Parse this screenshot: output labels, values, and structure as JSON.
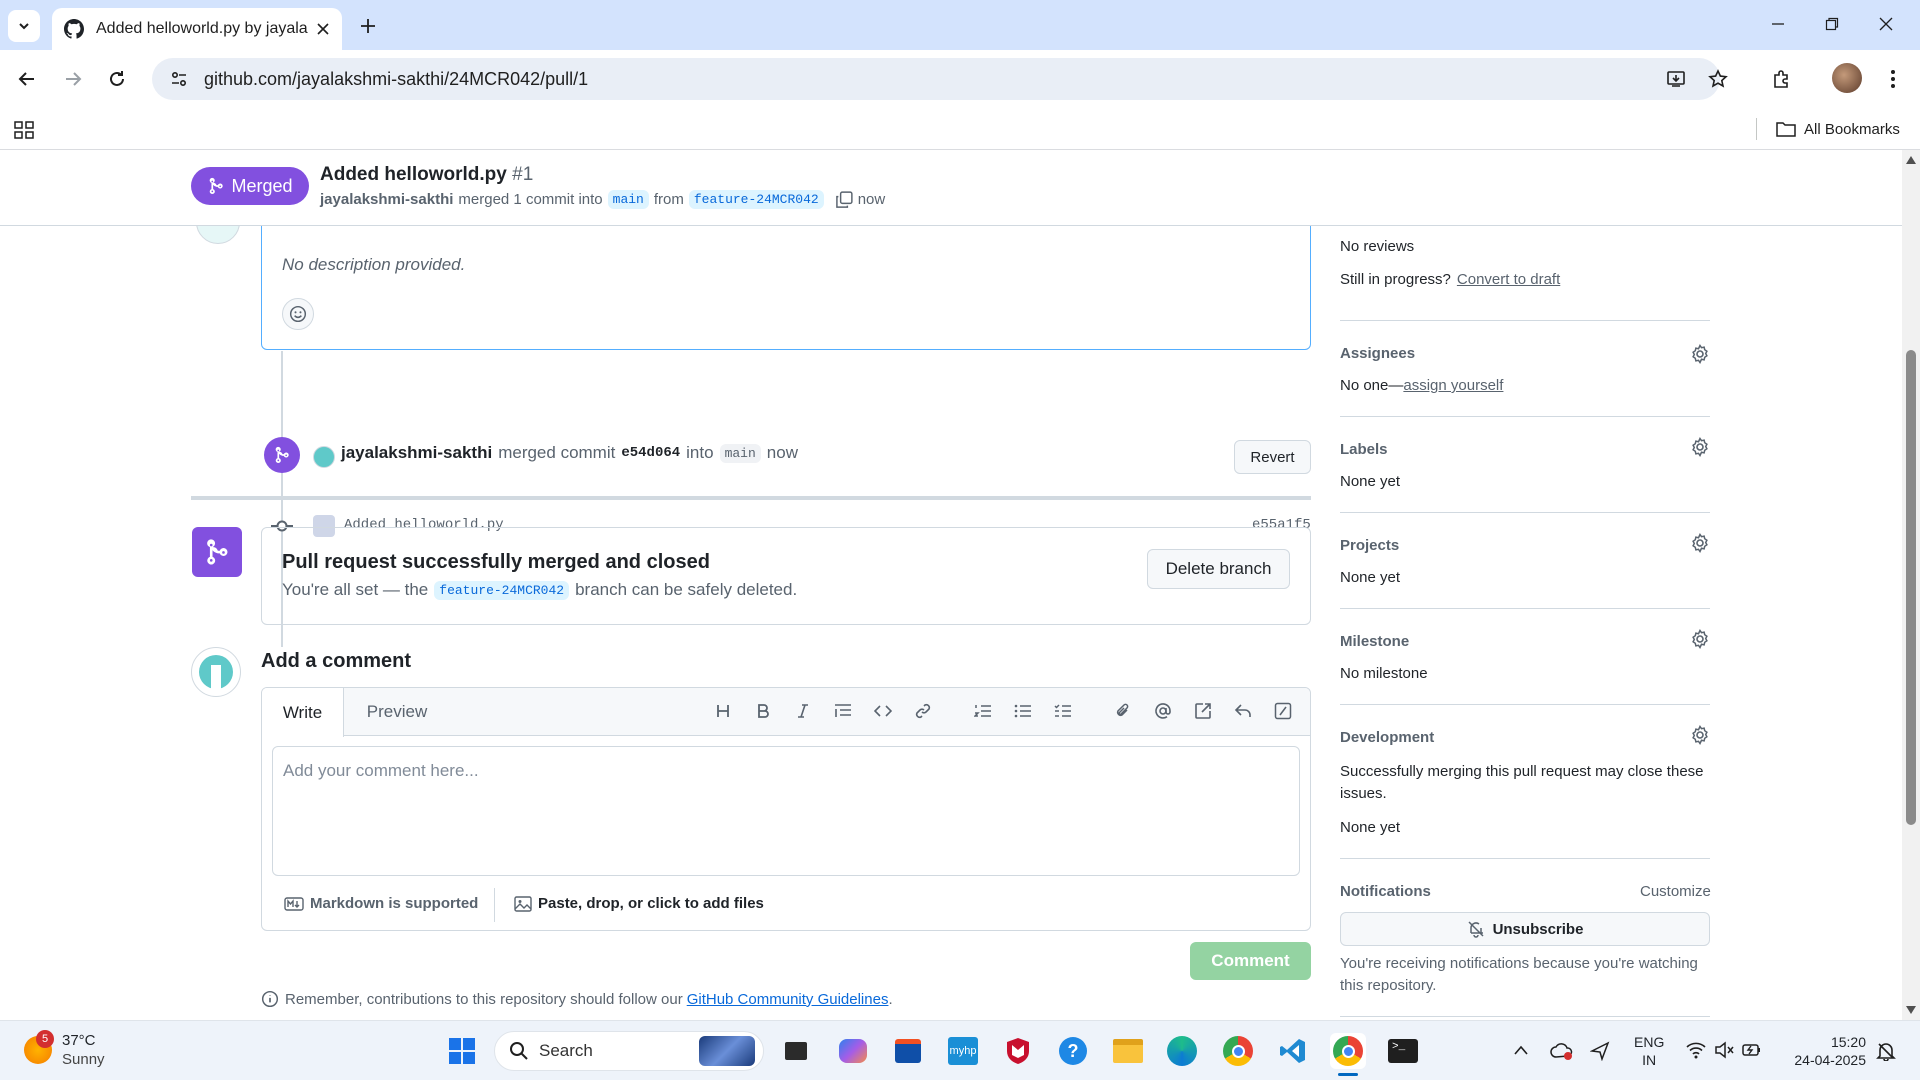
{
  "browser": {
    "tab_title": "Added helloworld.py by jayalakshmi-sakthi",
    "url": "github.com/jayalakshmi-sakthi/24MCR042/pull/1",
    "bookmarks_label": "All Bookmarks"
  },
  "pr": {
    "state_label": "Merged",
    "title": "Added helloworld.py",
    "number": "#1",
    "author": "jayalakshmi-sakthi",
    "merged_text": "merged 1 commit into",
    "base_branch": "main",
    "from_text": "from",
    "head_branch": "feature-24MCR042",
    "time": "now"
  },
  "timeline": {
    "description": "No description provided.",
    "commit_message": "Added helloworld.py",
    "commit_sha": "e55a1f5",
    "merge_actor": "jayalakshmi-sakthi",
    "merge_text": "merged commit",
    "merge_sha": "e54d064",
    "merge_into": "into",
    "merge_branch": "main",
    "merge_time": "now",
    "revert_label": "Revert"
  },
  "merged_box": {
    "title": "Pull request successfully merged and closed",
    "text_before": "You're all set — the",
    "branch": "feature-24MCR042",
    "text_after": "branch can be safely deleted.",
    "delete_label": "Delete branch"
  },
  "comment": {
    "heading": "Add a comment",
    "tab_write": "Write",
    "tab_preview": "Preview",
    "placeholder": "Add your comment here...",
    "markdown_label": "Markdown is supported",
    "attach_label": "Paste, drop, or click to add files",
    "submit_label": "Comment",
    "guidelines_before": "Remember, contributions to this repository should follow our",
    "guidelines_link": "GitHub Community Guidelines",
    "guidelines_after": "."
  },
  "sidebar": {
    "no_reviews": "No reviews",
    "still_in_progress": "Still in progress?",
    "convert_draft": "Convert to draft",
    "assignees_h": "Assignees",
    "assignees_v": "No one—",
    "assign_yourself": "assign yourself",
    "labels_h": "Labels",
    "labels_v": "None yet",
    "projects_h": "Projects",
    "projects_v": "None yet",
    "milestone_h": "Milestone",
    "milestone_v": "No milestone",
    "development_h": "Development",
    "development_desc": "Successfully merging this pull request may close these issues.",
    "development_v": "None yet",
    "notifications_h": "Notifications",
    "customize": "Customize",
    "unsubscribe": "Unsubscribe",
    "notif_desc": "You're receiving notifications because you're watching this repository."
  },
  "taskbar": {
    "weather_temp": "37°C",
    "weather_desc": "Sunny",
    "weather_badge": "5",
    "search_label": "Search",
    "lang_1": "ENG",
    "lang_2": "IN",
    "time": "15:20",
    "date": "24-04-2025"
  },
  "colors": {
    "merged_purple": "#8250df",
    "link_blue": "#0969da",
    "comment_green": "#94d3a2",
    "chrome_tab_bg": "#d3e3fd"
  }
}
